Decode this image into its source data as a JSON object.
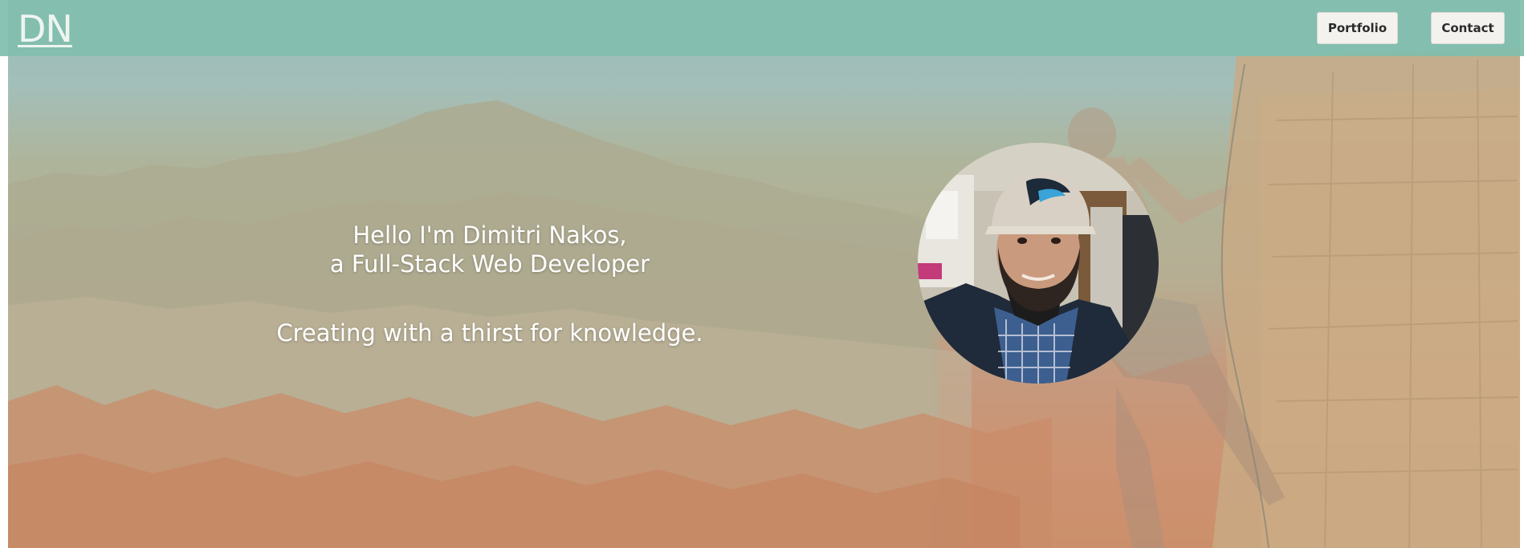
{
  "header": {
    "logo_text": "DN",
    "nav": {
      "portfolio_label": "Portfolio",
      "contact_label": "Contact"
    }
  },
  "hero": {
    "greeting_line1": "Hello I'm Dimitri Nakos,",
    "greeting_line2": "a Full-Stack Web Developer",
    "tagline": "Creating with a thirst for knowledge."
  },
  "colors": {
    "header_bg": "#81beac",
    "button_bg": "#f3f2ee",
    "hero_text": "#ffffff"
  }
}
